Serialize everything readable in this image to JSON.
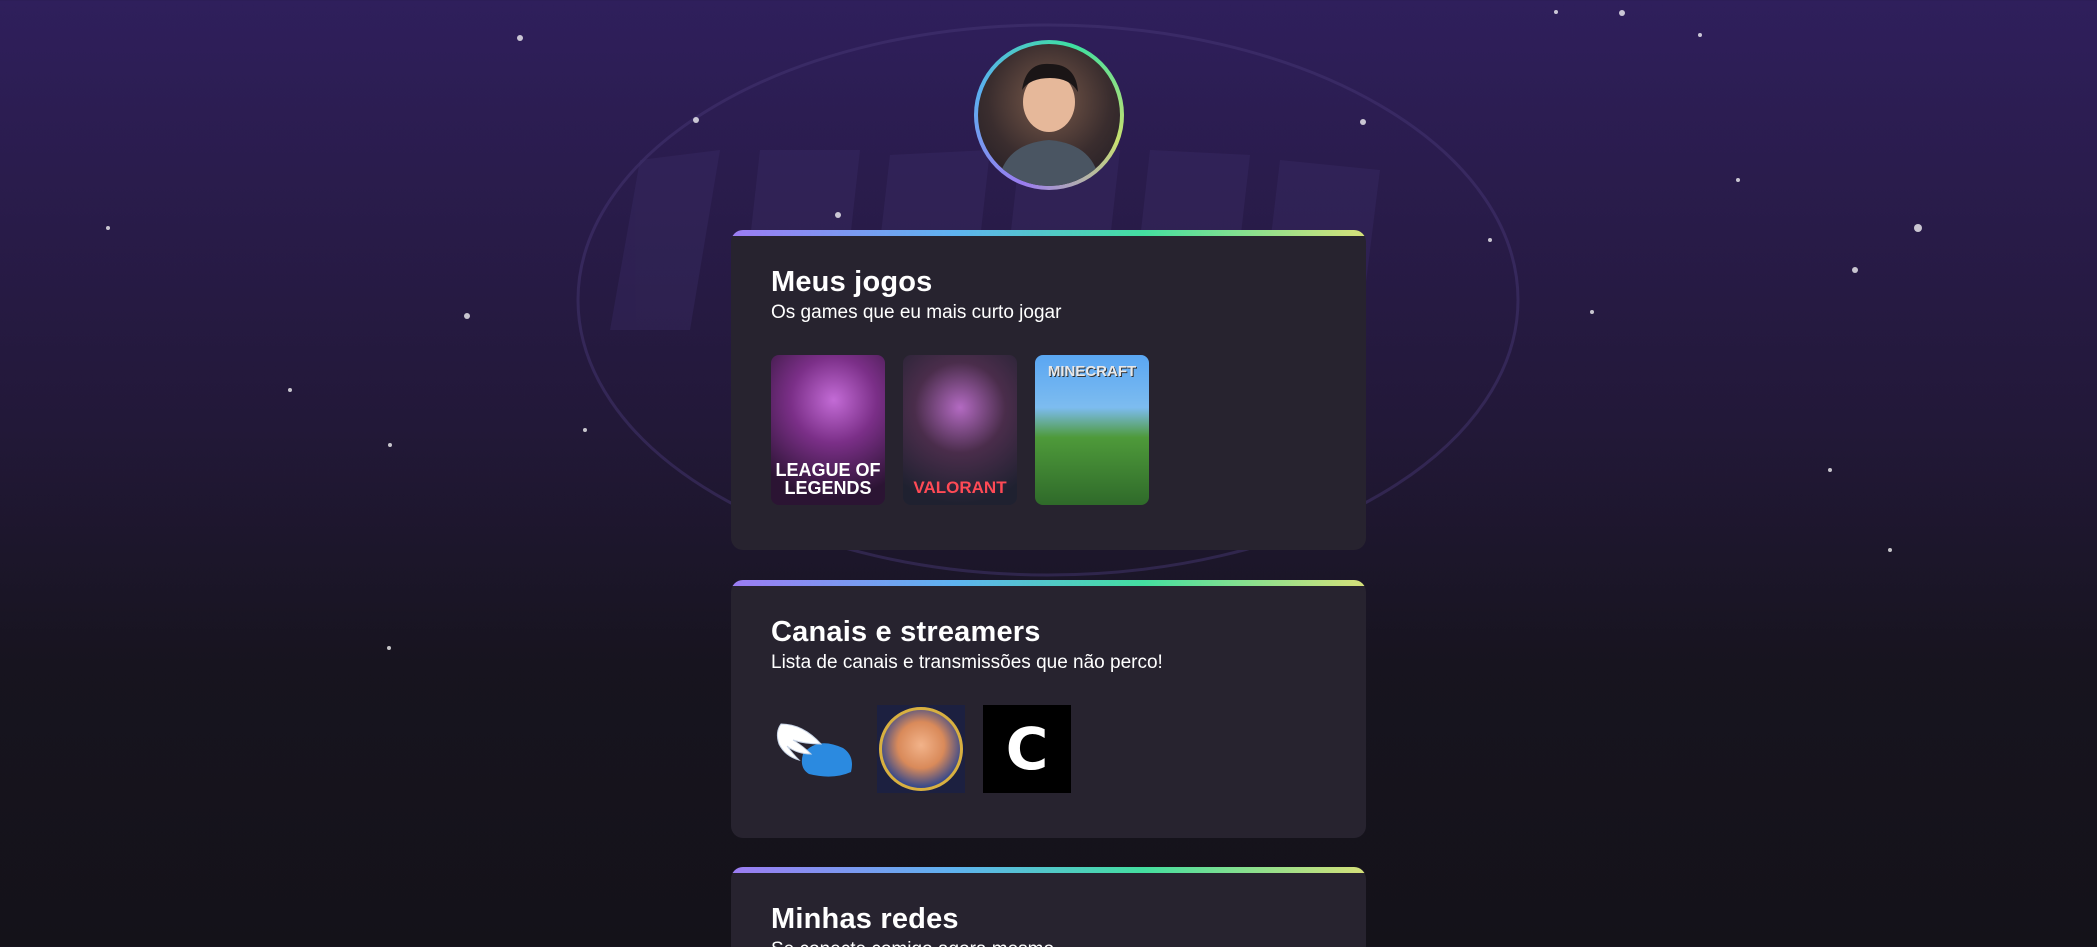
{
  "profile": {
    "avatar_icon": "profile-photo"
  },
  "sections": {
    "games": {
      "title": "Meus jogos",
      "subtitle": "Os games que eu mais curto jogar",
      "items": [
        {
          "label": "LEAGUE OF LEGENDS",
          "icon": "league-of-legends-cover"
        },
        {
          "label": "VALORANT",
          "icon": "valorant-cover"
        },
        {
          "label": "MINECRAFT",
          "icon": "minecraft-cover"
        }
      ]
    },
    "channels": {
      "title": "Canais e streamers",
      "subtitle": "Lista de canais e transmissões que não perco!",
      "items": [
        {
          "icon": "winged-helmet-logo"
        },
        {
          "icon": "cartoon-streamer-avatar"
        },
        {
          "icon": "c-letter-logo",
          "glyph": "C"
        }
      ]
    },
    "networks": {
      "title": "Minhas redes",
      "subtitle": "Se conecte comigo agora mesmo"
    }
  },
  "colors": {
    "accent_gradient": [
      "#9c7cf2",
      "#5fb2f0",
      "#44dea0",
      "#d6e07a"
    ],
    "card_bg": "#27232f",
    "page_bg_top": "#2f1f5c",
    "page_bg_bottom": "#141219"
  }
}
